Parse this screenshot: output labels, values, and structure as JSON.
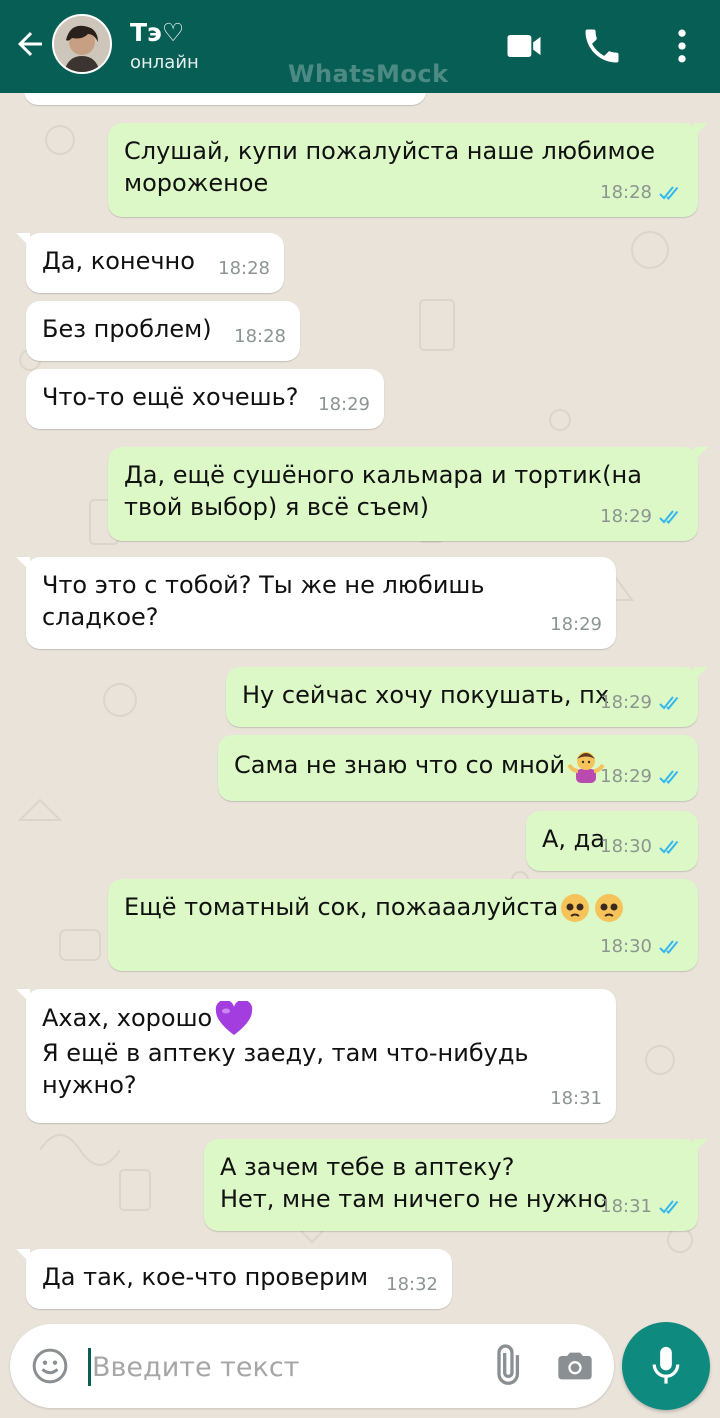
{
  "header": {
    "contact_name": "Тэ♡",
    "status": "онлайн",
    "watermark": "WhatsMock"
  },
  "colors": {
    "header": "#075e54",
    "incoming_bubble": "#ffffff",
    "outgoing_bubble": "#dcf8c6",
    "read_check": "#34b7f1",
    "mic_button": "#0f8a7e"
  },
  "messages": [
    {
      "direction": "out",
      "text": "Слушай, купи пожалуйста наше любимое\nмороженое",
      "time": "18:28",
      "status": "read"
    },
    {
      "direction": "in",
      "text": "Да, конечно",
      "time": "18:28"
    },
    {
      "direction": "in",
      "text": "Без проблем)",
      "time": "18:28"
    },
    {
      "direction": "in",
      "text": "Что-то ещё хочешь?",
      "time": "18:29"
    },
    {
      "direction": "out",
      "text": "Да, ещё сушёного кальмара и тортик(на\nтвой выбор) я всё съем)",
      "time": "18:29",
      "status": "read"
    },
    {
      "direction": "in",
      "text": "Что это с тобой? Ты же не любишь сладкое?",
      "time": "18:29"
    },
    {
      "direction": "out",
      "text": "Ну сейчас хочу покушать, пх",
      "time": "18:29",
      "status": "read"
    },
    {
      "direction": "out",
      "text": "Сама не знаю что со мной",
      "emoji": "person-shrugging",
      "time": "18:29",
      "status": "read"
    },
    {
      "direction": "out",
      "text": "А, да",
      "time": "18:30",
      "status": "read"
    },
    {
      "direction": "out",
      "text": "Ещё томатный сок, пожааалуйста",
      "emoji": "pleading-face-x2",
      "time": "18:30",
      "status": "read"
    },
    {
      "direction": "in",
      "text": "Ахах, хорошо",
      "emoji": "purple-heart",
      "text2": "Я ещё в аптеку заеду, там что-нибудь\nнужно?",
      "time": "18:31"
    },
    {
      "direction": "out",
      "text": "А зачем тебе в аптеку?\nНет, мне там ничего не нужно",
      "time": "18:31",
      "status": "read"
    },
    {
      "direction": "in",
      "text": "Да так, кое-что проверим",
      "time": "18:32"
    }
  ],
  "composer": {
    "placeholder": "Введите текст",
    "value": ""
  },
  "icons": [
    "back-arrow-icon",
    "avatar",
    "video-call-icon",
    "voice-call-icon",
    "more-vert-icon",
    "emoji-icon",
    "attach-icon",
    "camera-icon",
    "mic-icon"
  ]
}
